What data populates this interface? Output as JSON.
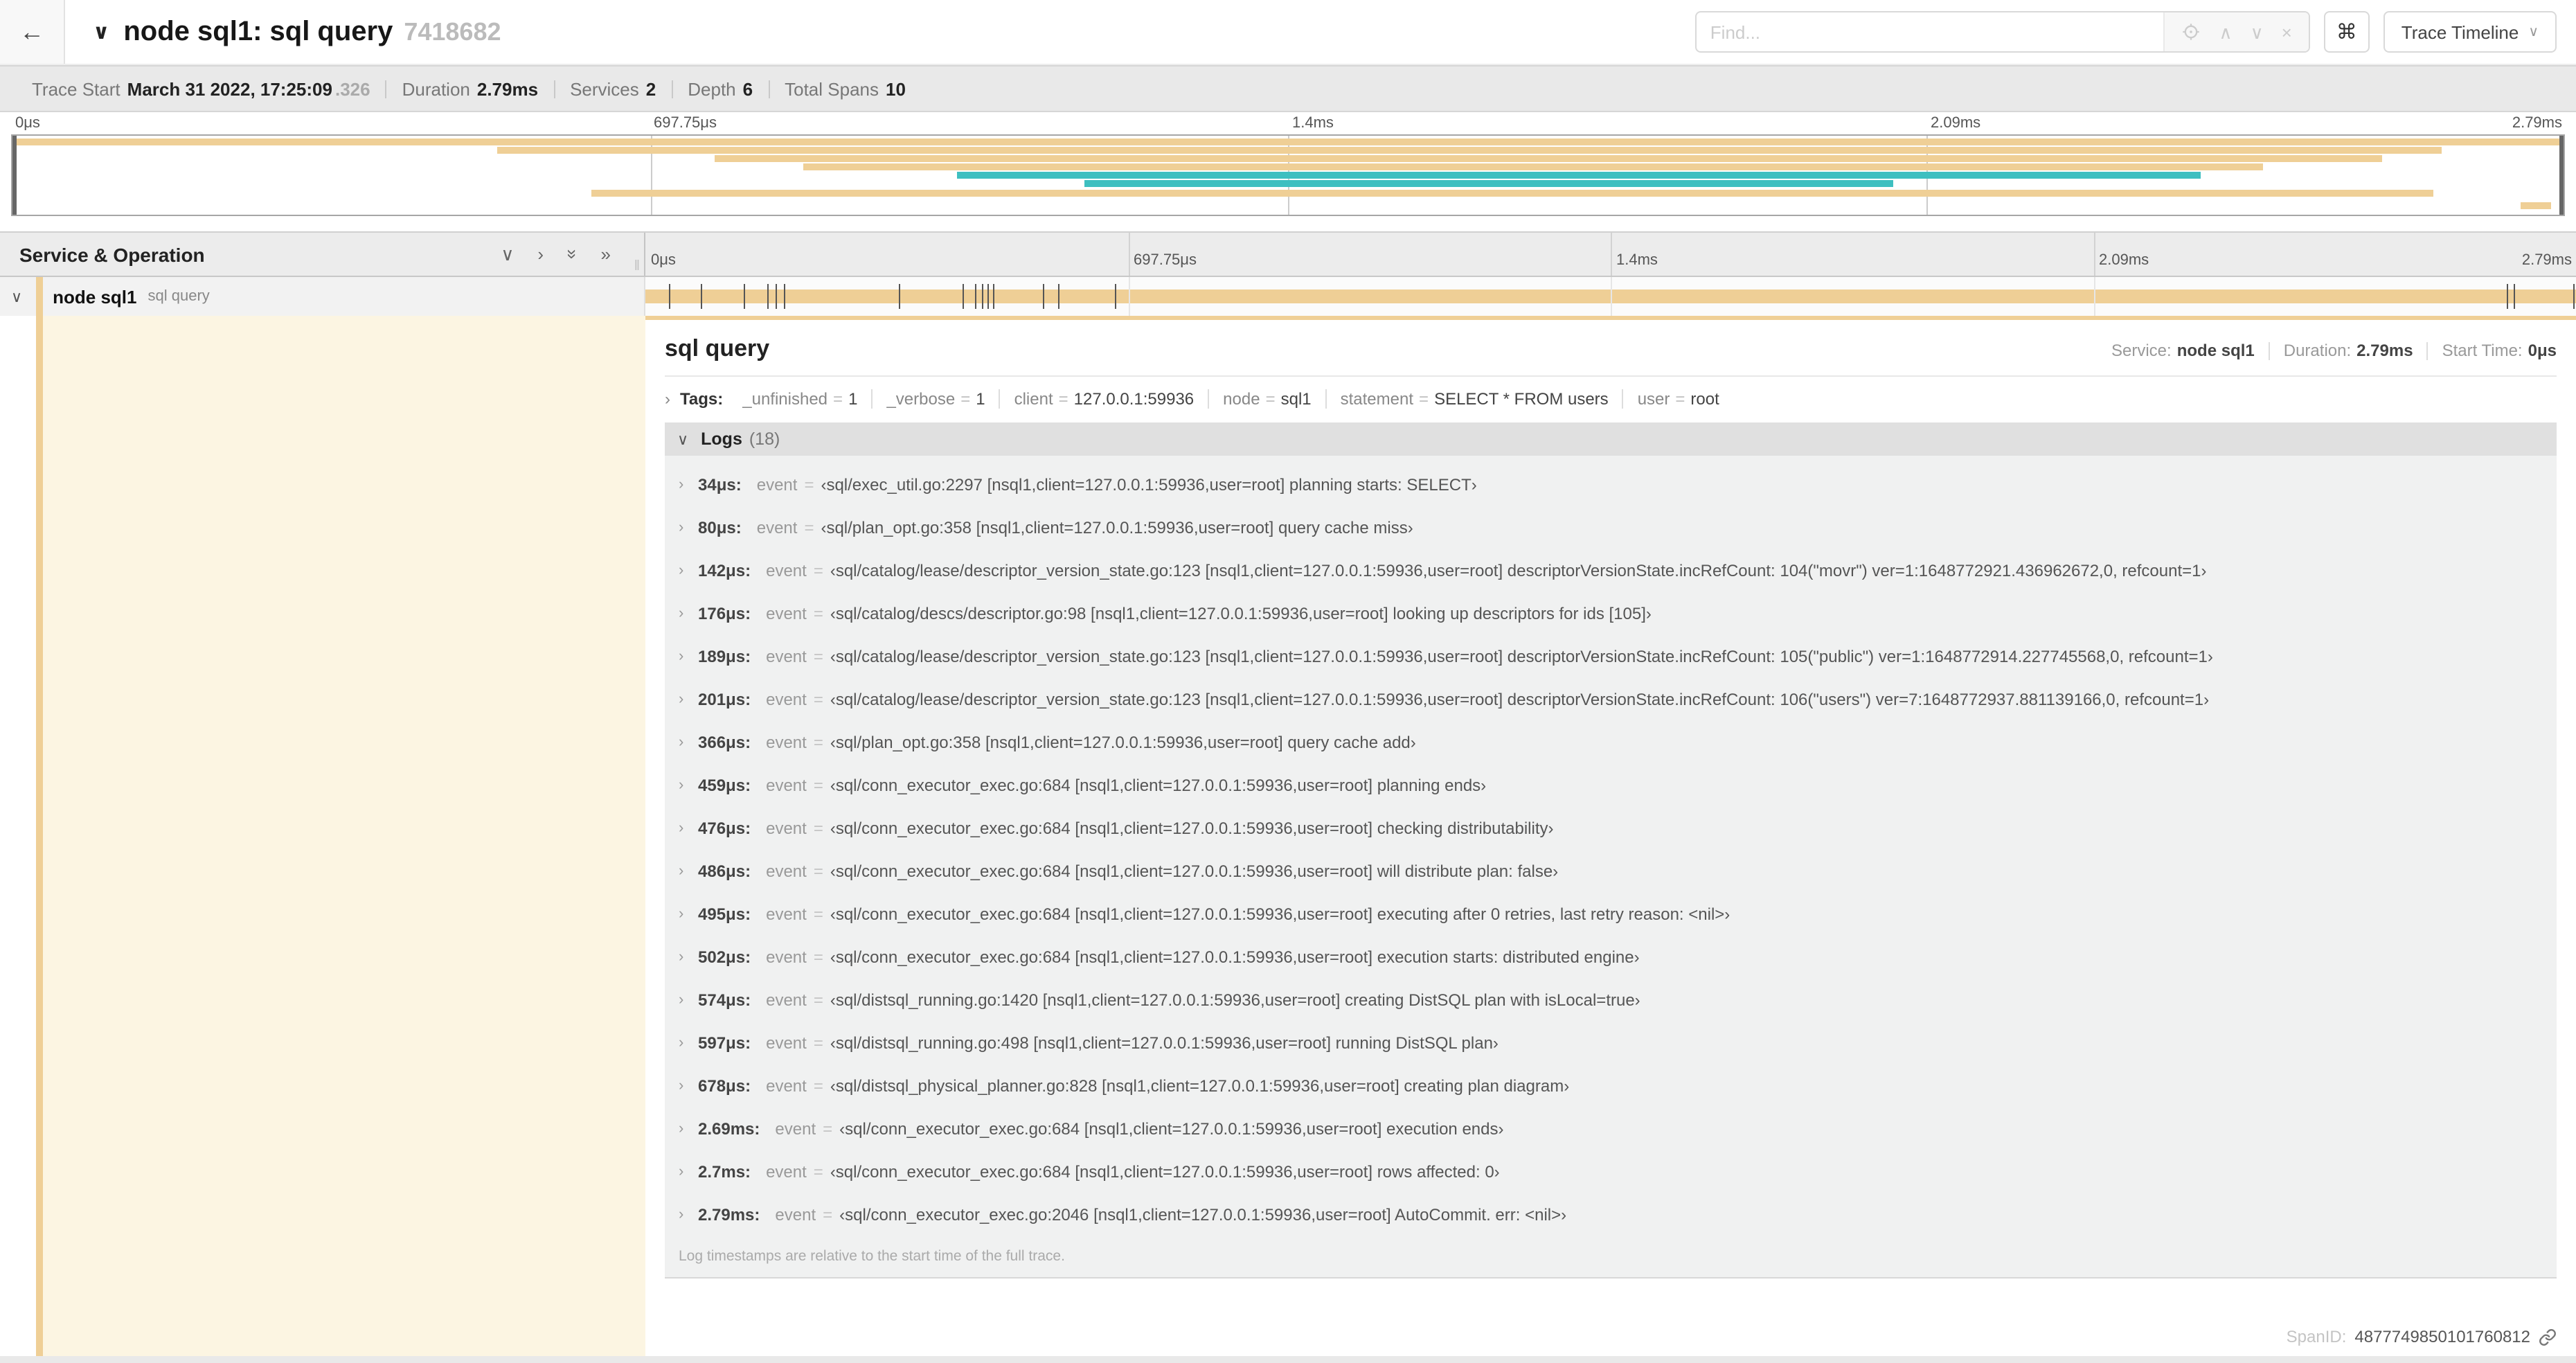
{
  "colors": {
    "tan": "#EFCF96",
    "teal": "#3EBFC0",
    "cream": "#FCF5E2"
  },
  "icons": {
    "back": "←",
    "collapse": "∨",
    "chevron_right": "›",
    "double_chevron": "»",
    "up": "∧",
    "down": "∨",
    "close": "×",
    "command": "⌘",
    "resizer": "‖"
  },
  "header": {
    "title": "node sql1: sql query",
    "trace_id": "7418682",
    "find_placeholder": "Find...",
    "view_select": "Trace Timeline"
  },
  "summary": {
    "items": [
      {
        "label": "Trace Start",
        "value": "March 31 2022, 17:25:09",
        "suffix": ".326"
      },
      {
        "label": "Duration",
        "value": "2.79ms"
      },
      {
        "label": "Services",
        "value": "2"
      },
      {
        "label": "Depth",
        "value": "6"
      },
      {
        "label": "Total Spans",
        "value": "10"
      }
    ]
  },
  "timeline": {
    "ticks": [
      {
        "label": "0μs",
        "pct": 0
      },
      {
        "label": "697.75μs",
        "pct": 25
      },
      {
        "label": "1.4ms",
        "pct": 50
      },
      {
        "label": "2.09ms",
        "pct": 75
      },
      {
        "label": "2.79ms",
        "pct": 100
      }
    ],
    "left_title": "Service & Operation"
  },
  "minimap": {
    "rows": [
      {
        "lane": 0,
        "start": 0,
        "end": 100,
        "color": "tan"
      },
      {
        "lane": 1,
        "start": 19,
        "end": 95.2,
        "color": "tan"
      },
      {
        "lane": 2,
        "start": 27.5,
        "end": 92.9,
        "color": "tan"
      },
      {
        "lane": 3,
        "start": 31,
        "end": 88.2,
        "color": "tan"
      },
      {
        "lane": 4,
        "start": 37,
        "end": 85.8,
        "color": "teal"
      },
      {
        "lane": 5,
        "start": 42,
        "end": 73.7,
        "color": "teal"
      },
      {
        "lane": 6,
        "start": 22.7,
        "end": 94.9,
        "color": "tan"
      },
      {
        "lane": 7,
        "start": 98.3,
        "end": 99.5,
        "color": "tan"
      }
    ]
  },
  "span_row": {
    "service": "node sql1",
    "operation": "sql query"
  },
  "detail": {
    "title": "sql query",
    "meta": [
      {
        "label": "Service:",
        "value": "node sql1"
      },
      {
        "label": "Duration:",
        "value": "2.79ms"
      },
      {
        "label": "Start Time:",
        "value": "0μs"
      }
    ],
    "tags": {
      "label": "Tags:",
      "items": [
        {
          "key": "_unfinished",
          "value": "1"
        },
        {
          "key": "_verbose",
          "value": "1"
        },
        {
          "key": "client",
          "value": "127.0.0.1:59936"
        },
        {
          "key": "node",
          "value": "sql1"
        },
        {
          "key": "statement",
          "value": "SELECT * FROM users"
        },
        {
          "key": "user",
          "value": "root"
        }
      ]
    },
    "logs": {
      "label": "Logs",
      "count": "(18)",
      "entries": [
        {
          "t": "34μs:",
          "key": "event",
          "value": "‹sql/exec_util.go:2297 [nsql1,client=127.0.0.1:59936,user=root] planning starts: SELECT›",
          "pct": 1.22
        },
        {
          "t": "80μs:",
          "key": "event",
          "value": "‹sql/plan_opt.go:358 [nsql1,client=127.0.0.1:59936,user=root] query cache miss›",
          "pct": 2.87
        },
        {
          "t": "142μs:",
          "key": "event",
          "value": "‹sql/catalog/lease/descriptor_version_state.go:123 [nsql1,client=127.0.0.1:59936,user=root] descriptorVersionState.incRefCount: 104(\"movr\") ver=1:1648772921.436962672,0, refcount=1›",
          "pct": 5.09
        },
        {
          "t": "176μs:",
          "key": "event",
          "value": "‹sql/catalog/descs/descriptor.go:98 [nsql1,client=127.0.0.1:59936,user=root] looking up descriptors for ids [105]›",
          "pct": 6.31
        },
        {
          "t": "189μs:",
          "key": "event",
          "value": "‹sql/catalog/lease/descriptor_version_state.go:123 [nsql1,client=127.0.0.1:59936,user=root] descriptorVersionState.incRefCount: 105(\"public\") ver=1:1648772914.227745568,0, refcount=1›",
          "pct": 6.77
        },
        {
          "t": "201μs:",
          "key": "event",
          "value": "‹sql/catalog/lease/descriptor_version_state.go:123 [nsql1,client=127.0.0.1:59936,user=root] descriptorVersionState.incRefCount: 106(\"users\") ver=7:1648772937.881139166,0, refcount=1›",
          "pct": 7.2
        },
        {
          "t": "366μs:",
          "key": "event",
          "value": "‹sql/plan_opt.go:358 [nsql1,client=127.0.0.1:59936,user=root] query cache add›",
          "pct": 13.12
        },
        {
          "t": "459μs:",
          "key": "event",
          "value": "‹sql/conn_executor_exec.go:684 [nsql1,client=127.0.0.1:59936,user=root] planning ends›",
          "pct": 16.45
        },
        {
          "t": "476μs:",
          "key": "event",
          "value": "‹sql/conn_executor_exec.go:684 [nsql1,client=127.0.0.1:59936,user=root] checking distributability›",
          "pct": 17.06
        },
        {
          "t": "486μs:",
          "key": "event",
          "value": "‹sql/conn_executor_exec.go:684 [nsql1,client=127.0.0.1:59936,user=root] will distribute plan: false›",
          "pct": 17.42
        },
        {
          "t": "495μs:",
          "key": "event",
          "value": "‹sql/conn_executor_exec.go:684 [nsql1,client=127.0.0.1:59936,user=root] executing after 0 retries, last retry reason: <nil>›",
          "pct": 17.74
        },
        {
          "t": "502μs:",
          "key": "event",
          "value": "‹sql/conn_executor_exec.go:684 [nsql1,client=127.0.0.1:59936,user=root] execution starts: distributed engine›",
          "pct": 18.0
        },
        {
          "t": "574μs:",
          "key": "event",
          "value": "‹sql/distsql_running.go:1420 [nsql1,client=127.0.0.1:59936,user=root] creating DistSQL plan with isLocal=true›",
          "pct": 20.57
        },
        {
          "t": "597μs:",
          "key": "event",
          "value": "‹sql/distsql_running.go:498 [nsql1,client=127.0.0.1:59936,user=root] running DistSQL plan›",
          "pct": 21.4
        },
        {
          "t": "678μs:",
          "key": "event",
          "value": "‹sql/distsql_physical_planner.go:828 [nsql1,client=127.0.0.1:59936,user=root] creating plan diagram›",
          "pct": 24.3
        },
        {
          "t": "2.69ms:",
          "key": "event",
          "value": "‹sql/conn_executor_exec.go:684 [nsql1,client=127.0.0.1:59936,user=root] execution ends›",
          "pct": 96.42
        },
        {
          "t": "2.7ms:",
          "key": "event",
          "value": "‹sql/conn_executor_exec.go:684 [nsql1,client=127.0.0.1:59936,user=root] rows affected: 0›",
          "pct": 96.77
        },
        {
          "t": "2.79ms:",
          "key": "event",
          "value": "‹sql/conn_executor_exec.go:2046 [nsql1,client=127.0.0.1:59936,user=root] AutoCommit. err: <nil>›",
          "pct": 99.9
        }
      ]
    },
    "note": "Log timestamps are relative to the start time of the full trace.",
    "span_id_label": "SpanID:",
    "span_id": "4877749850101760812"
  }
}
